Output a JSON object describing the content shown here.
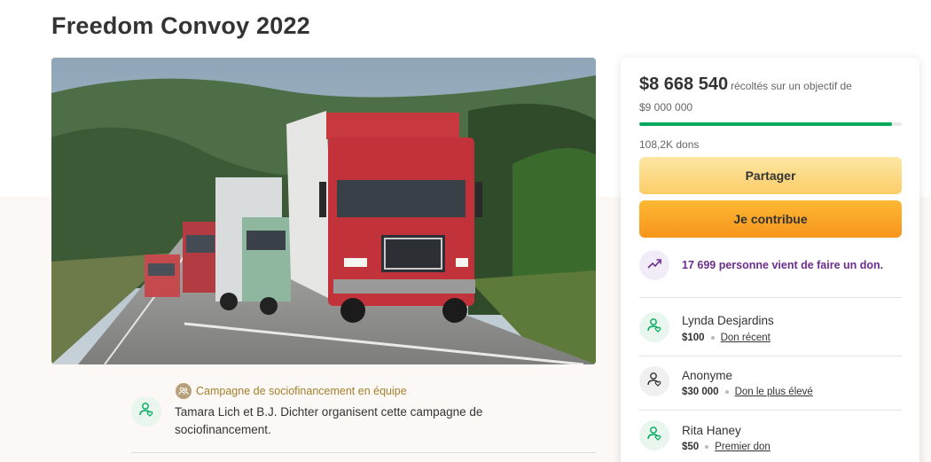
{
  "page": {
    "title": "Freedom Convoy 2022"
  },
  "organizer": {
    "team_label": "Campagne de sociofinancement en équipe",
    "text": "Tamara Lich et B.J. Dichter organisent cette campagne de sociofinancement."
  },
  "donation": {
    "raised": "$8 668 540",
    "raised_text": "récoltés sur un objectif de",
    "goal": "$9 000 000",
    "progress": 0.963,
    "donation_count": "108,2K dons",
    "share_label": "Partager",
    "donate_label": "Je contribue",
    "trending_text": "17 699 personne vient de faire un don.",
    "donors": [
      {
        "name": "Lynda Desjardins",
        "amount": "$100",
        "tag": "Don récent"
      },
      {
        "name": "Anonyme",
        "amount": "$30 000",
        "tag": "Don le plus élevé"
      },
      {
        "name": "Rita Haney",
        "amount": "$50",
        "tag": "Premier don"
      }
    ]
  },
  "colors": {
    "progress": "#02a95c",
    "trending": "#6b2e8c",
    "team": "#a57f2c",
    "share_button": "#fbcd68",
    "donate_button": "#f8951d"
  },
  "icons": {
    "team": "people-icon",
    "organizer": "user-heart-icon",
    "trending": "trending-up-icon",
    "donor": "user-heart-icon"
  }
}
